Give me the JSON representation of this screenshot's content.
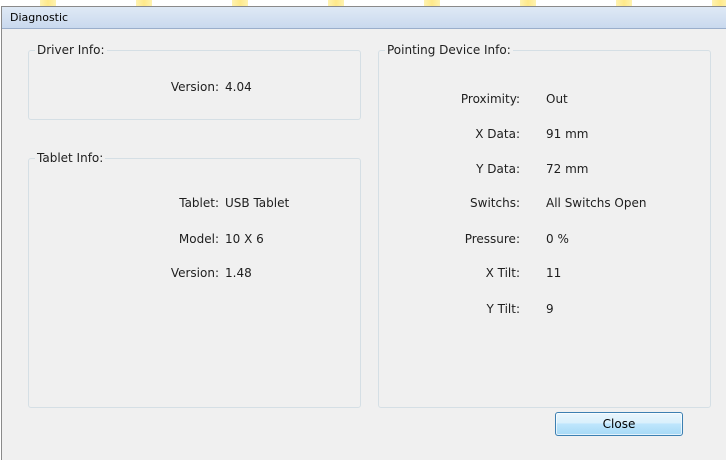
{
  "window": {
    "title": "Diagnostic"
  },
  "driver_info": {
    "label": "Driver Info:",
    "version_label": "Version:",
    "version_value": "4.04"
  },
  "tablet_info": {
    "label": "Tablet Info:",
    "rows": [
      {
        "label": "Tablet:",
        "value": "USB Tablet"
      },
      {
        "label": "Model:",
        "value": "10 X 6"
      },
      {
        "label": "Version:",
        "value": "1.48"
      }
    ]
  },
  "pointing_device_info": {
    "label": "Pointing Device Info:",
    "rows": [
      {
        "label": "Proximity:",
        "value": "Out"
      },
      {
        "label": "X Data:",
        "value": "91 mm"
      },
      {
        "label": "Y Data:",
        "value": "72 mm"
      },
      {
        "label": "Switchs:",
        "value": "All Switchs Open"
      },
      {
        "label": "Pressure:",
        "value": "0 %"
      },
      {
        "label": "X Tilt:",
        "value": "11"
      },
      {
        "label": "Y Tilt:",
        "value": "9"
      }
    ]
  },
  "buttons": {
    "close_label": "Close"
  }
}
